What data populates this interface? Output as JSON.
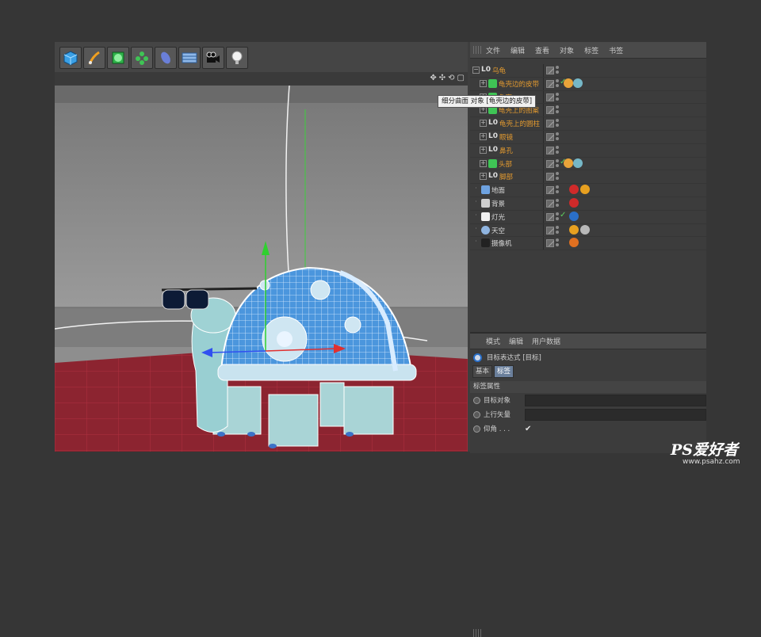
{
  "toolbar": {
    "tools": [
      "cube-tool-icon",
      "pen-tool-icon",
      "subdivision-tool-icon",
      "array-tool-icon",
      "deformer-tool-icon",
      "floor-tool-icon",
      "camera-tool-icon",
      "light-tool-icon"
    ]
  },
  "viewport": {
    "nav_icons": [
      "✥",
      "✣",
      "⟲",
      "▢"
    ]
  },
  "object_manager": {
    "menu": [
      "文件",
      "编辑",
      "查看",
      "对象",
      "标签",
      "书签"
    ],
    "tooltip": "细分曲面 对象 [龟壳边的皮带]",
    "rows": [
      {
        "name": "乌龟",
        "color": "orange",
        "indent": 0,
        "icon": "null"
      },
      {
        "name": "龟壳边的皮带",
        "color": "orange",
        "indent": 1,
        "icon": "subdiv",
        "check": true
      },
      {
        "name": "龟壳",
        "color": "orange",
        "indent": 1,
        "icon": "subdiv"
      },
      {
        "name": "龟壳上的图案",
        "color": "orange",
        "indent": 1,
        "icon": "subdiv"
      },
      {
        "name": "龟壳上的圆柱",
        "color": "orange",
        "indent": 1,
        "icon": "null"
      },
      {
        "name": "眼镜",
        "color": "orange",
        "indent": 1,
        "icon": "null"
      },
      {
        "name": "鼻孔",
        "color": "orange",
        "indent": 1,
        "icon": "null"
      },
      {
        "name": "头部",
        "color": "orange",
        "indent": 1,
        "icon": "subdiv",
        "check": true
      },
      {
        "name": "脚部",
        "color": "orange",
        "indent": 1,
        "icon": "null"
      },
      {
        "name": "地面",
        "color": "white",
        "indent": 0,
        "icon": "floor"
      },
      {
        "name": "背景",
        "color": "white",
        "indent": 0,
        "icon": "bg"
      },
      {
        "name": "灯光",
        "color": "white",
        "indent": 0,
        "icon": "light",
        "check": true
      },
      {
        "name": "天空",
        "color": "white",
        "indent": 0,
        "icon": "sky"
      },
      {
        "name": "摄像机",
        "color": "white",
        "indent": 0,
        "icon": "camera"
      }
    ]
  },
  "attribute_manager": {
    "menu": [
      "模式",
      "编辑",
      "用户数据"
    ],
    "title": "目标表达式 [目标]",
    "tabs": [
      "基本",
      "标签"
    ],
    "section": "标签属性",
    "fields": [
      {
        "label": "目标对象",
        "value": ""
      },
      {
        "label": "上行矢量",
        "value": ""
      },
      {
        "label": "仰角 . . .",
        "value": "✔"
      }
    ]
  },
  "watermark": {
    "text": "PS爱好者",
    "url": "www.psahz.com"
  },
  "colors": {
    "accent_orange": "#e39a2f",
    "check_green": "#5ed05e",
    "shell_blue": "#4a9be0",
    "floor_red": "#8c2430"
  }
}
